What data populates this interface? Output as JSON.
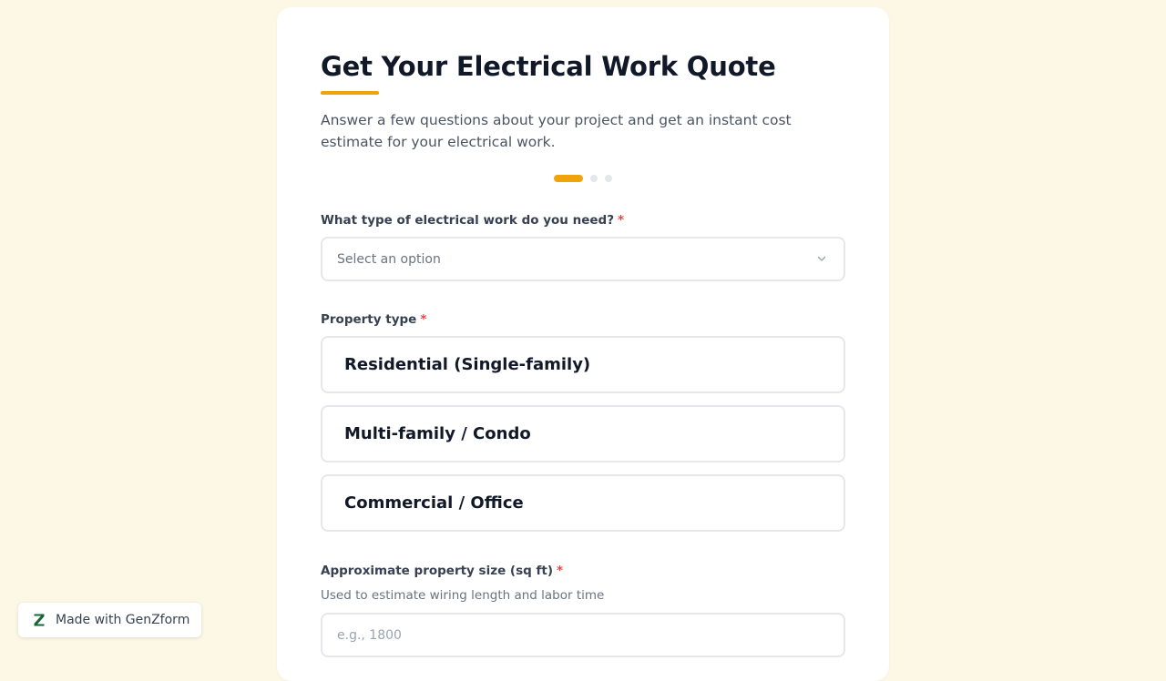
{
  "form": {
    "title": "Get Your Electrical Work Quote",
    "subtitle": "Answer a few questions about your project and get an instant cost estimate for your electrical work.",
    "accent_color": "#f0a30a",
    "progress": {
      "total_steps": 3,
      "current_step": 1
    },
    "work_type": {
      "label": "What type of electrical work do you need?",
      "required_mark": "*",
      "placeholder": "Select an option",
      "icon": "chevron-down-icon"
    },
    "property_type": {
      "label": "Property type",
      "required_mark": "*",
      "options": [
        "Residential (Single-family)",
        "Multi-family / Condo",
        "Commercial / Office"
      ]
    },
    "property_size": {
      "label": "Approximate property size (sq ft)",
      "required_mark": "*",
      "help": "Used to estimate wiring length and labor time",
      "placeholder": "e.g., 1800"
    }
  },
  "badge": {
    "text": "Made with GenZform",
    "logo_color": "#166534",
    "icon": "genzform-logo-icon"
  }
}
